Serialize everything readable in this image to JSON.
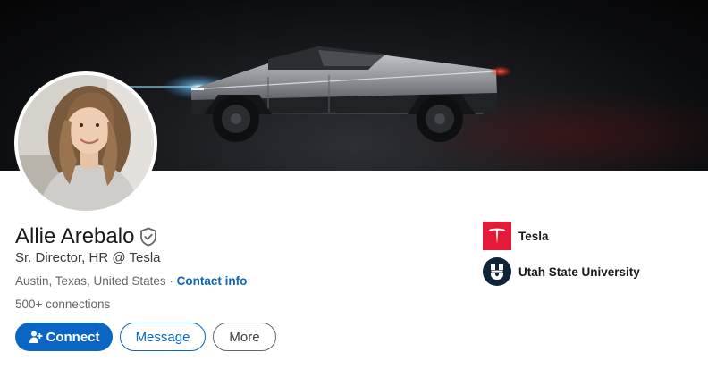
{
  "profile": {
    "name": "Allie Arebalo",
    "headline": "Sr. Director, HR @ Tesla",
    "location": "Austin, Texas, United States",
    "separator": "·",
    "contact_info_label": "Contact info",
    "connections": "500+ connections"
  },
  "actions": {
    "connect_label": "Connect",
    "message_label": "Message",
    "more_label": "More"
  },
  "organizations": [
    {
      "name": "Tesla",
      "logo": "tesla-logo",
      "color": "#e31937"
    },
    {
      "name": "Utah State University",
      "logo": "usu-logo",
      "color": "#0f2439"
    }
  ],
  "colors": {
    "accent": "#0a66c2",
    "text_primary": "#191919",
    "text_secondary": "#666666"
  },
  "icons": {
    "verified": "shield-check-icon",
    "connect": "person-add-icon"
  }
}
